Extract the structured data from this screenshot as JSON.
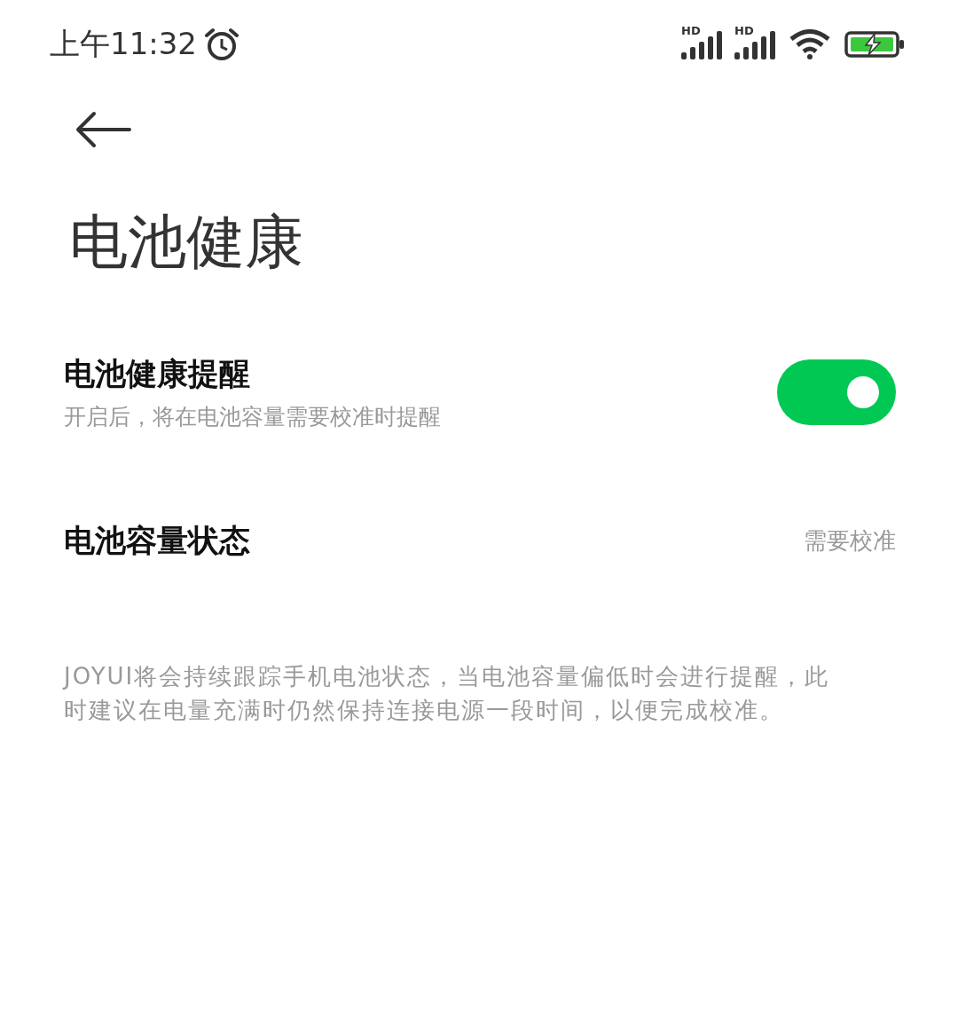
{
  "status_bar": {
    "time": "上午11:32",
    "signal_labels": [
      "HD",
      "HD"
    ],
    "battery_charging": true
  },
  "title": "电池健康",
  "settings": [
    {
      "kind": "toggle",
      "label": "电池健康提醒",
      "description": "开启后，将在电池容量需要校准时提醒",
      "on": true
    },
    {
      "kind": "value",
      "label": "电池容量状态",
      "value": "需要校准"
    }
  ],
  "note": "JOYUI将会持续跟踪手机电池状态，当电池容量偏低时会进行提醒，此时建议在电量充满时仍然保持连接电源一段时间，以便完成校准。"
}
